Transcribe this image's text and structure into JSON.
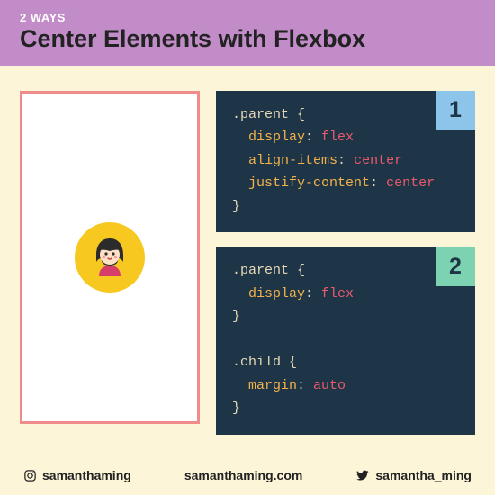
{
  "header": {
    "overline": "2 WAYS",
    "title": "Center Elements with Flexbox"
  },
  "code_cards": [
    {
      "badge": "1",
      "lines": [
        {
          "selector": ".parent",
          "open": " {"
        },
        {
          "indent": "  ",
          "prop": "display",
          "sep": ": ",
          "val": "flex"
        },
        {
          "indent": "  ",
          "prop": "align-items",
          "sep": ": ",
          "val": "center"
        },
        {
          "indent": "  ",
          "prop": "justify-content",
          "sep": ": ",
          "val": "center"
        },
        {
          "close": "}"
        }
      ]
    },
    {
      "badge": "2",
      "lines": [
        {
          "selector": ".parent",
          "open": " {"
        },
        {
          "indent": "  ",
          "prop": "display",
          "sep": ": ",
          "val": "flex"
        },
        {
          "close": "}"
        },
        {
          "blank": true
        },
        {
          "selector": ".child",
          "open": " {"
        },
        {
          "indent": "  ",
          "prop": "margin",
          "sep": ": ",
          "val": "auto"
        },
        {
          "close": "}"
        }
      ]
    }
  ],
  "footer": {
    "instagram": "samanthaming",
    "website": "samanthaming.com",
    "twitter": "samantha_ming"
  }
}
